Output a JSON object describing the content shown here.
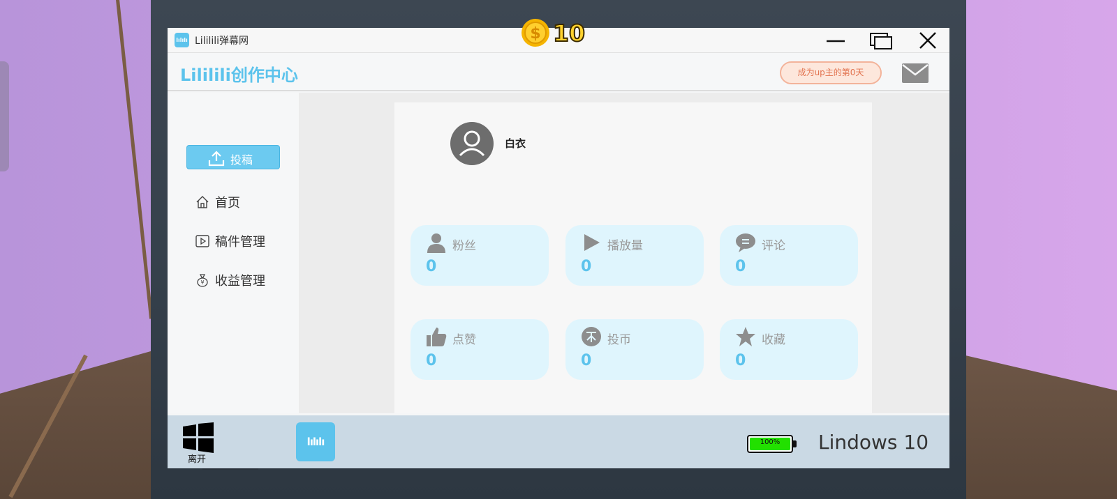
{
  "window": {
    "title": "Lililili弹幕网",
    "logo_text": "lılılı"
  },
  "hud": {
    "coins": "10",
    "coin_icon": "dollar-coin-icon"
  },
  "header": {
    "brand": "Lililili创作中心",
    "up_days_badge": "成为up主的第0天",
    "mail_icon": "mail-icon"
  },
  "sidebar": {
    "upload_label": "投稿",
    "items": [
      {
        "label": "首页",
        "icon": "home-icon"
      },
      {
        "label": "稿件管理",
        "icon": "video-icon"
      },
      {
        "label": "收益管理",
        "icon": "money-bag-icon"
      }
    ]
  },
  "profile": {
    "username": "白衣"
  },
  "stats": [
    {
      "label": "粉丝",
      "value": "0",
      "icon": "person-icon"
    },
    {
      "label": "播放量",
      "value": "0",
      "icon": "play-icon"
    },
    {
      "label": "评论",
      "value": "0",
      "icon": "comment-icon"
    },
    {
      "label": "点赞",
      "value": "0",
      "icon": "thumbs-up-icon"
    },
    {
      "label": "投币",
      "value": "0",
      "icon": "coin-icon"
    },
    {
      "label": "收藏",
      "value": "0",
      "icon": "star-icon"
    }
  ],
  "taskbar": {
    "start_label": "离开",
    "app_icon_text": "lılılı",
    "battery_percent": 100,
    "battery_text": "100%",
    "os_name": "Lindows 10"
  },
  "colors": {
    "accent": "#5cc3ec",
    "stat_card": "#dff5fd",
    "badge_text": "#e2724e",
    "battery_fill": "#22e000",
    "coin": "#ffd22e"
  }
}
